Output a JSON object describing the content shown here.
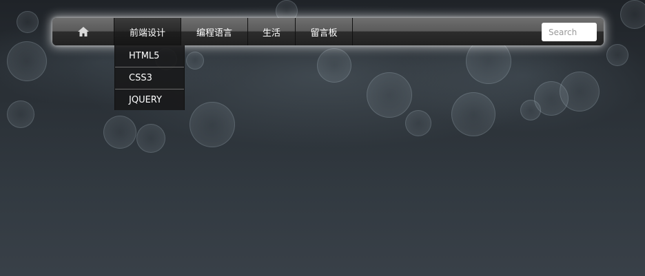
{
  "nav": {
    "home_icon": "home-icon",
    "items": [
      {
        "label": "前端设计",
        "active": true
      },
      {
        "label": "编程语言"
      },
      {
        "label": "生活"
      },
      {
        "label": "留言板"
      }
    ],
    "search_placeholder": "Search"
  },
  "dropdown": {
    "items": [
      {
        "label": "HTML5"
      },
      {
        "label": "CSS3"
      },
      {
        "label": "JQUERY"
      }
    ]
  },
  "colors": {
    "navbar_top": "#6f6f6f",
    "navbar_bottom": "#222222",
    "background": "#2a3036",
    "text": "#ffffff"
  }
}
